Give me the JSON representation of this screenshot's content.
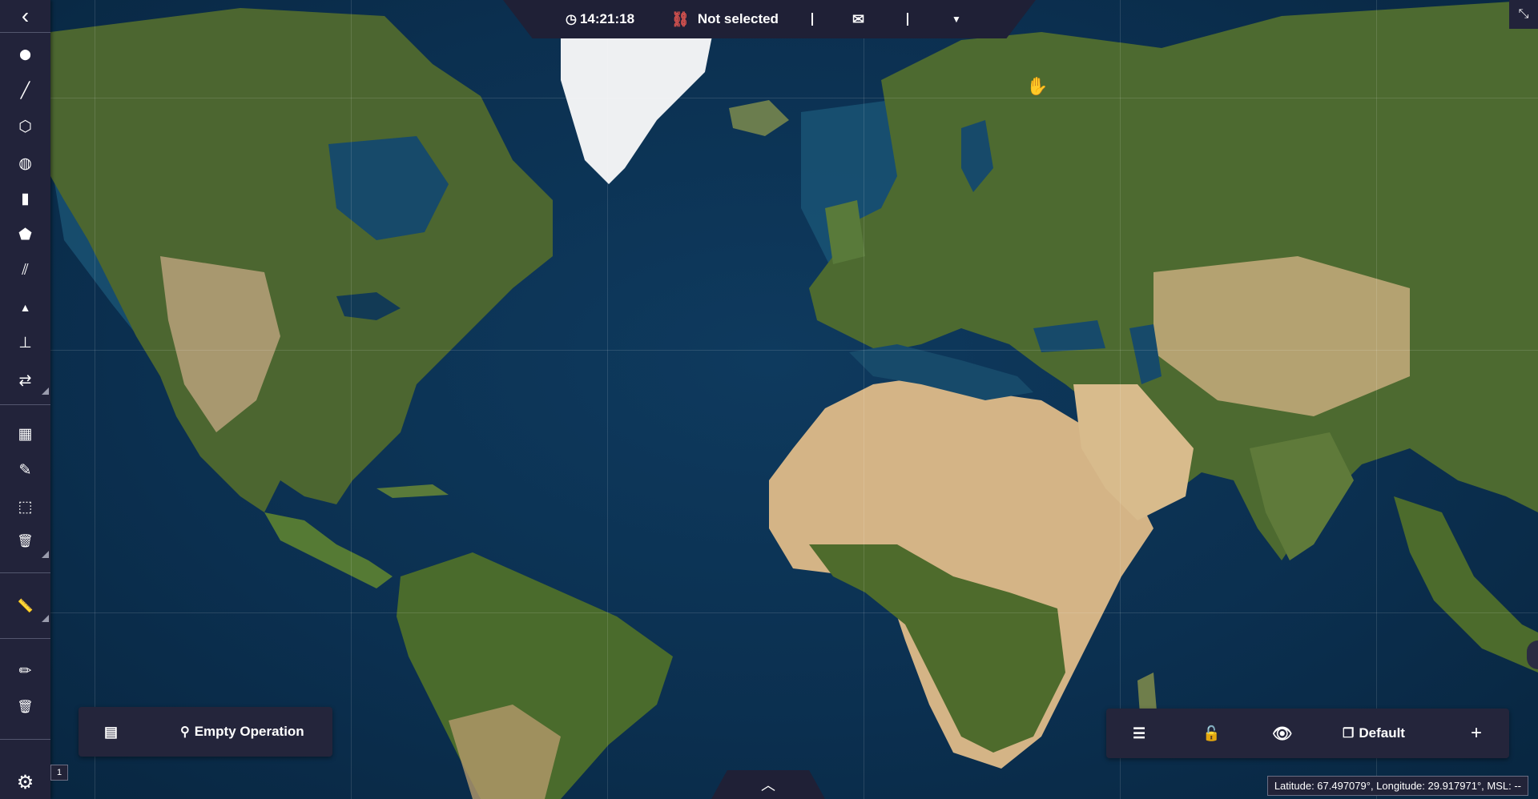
{
  "topbar": {
    "clock_icon": "clock-icon",
    "time": "14:21:18",
    "link_icon": "link-broken-icon",
    "link_icon_color": "#d9534f",
    "selection": "Not selected",
    "mail_icon": "envelope-icon",
    "dropdown_icon": "caret-down-icon"
  },
  "sidebar": {
    "items": [
      {
        "icon": "chevron-left-icon",
        "glyph": "‹"
      },
      {
        "icon": "map-pin-icon",
        "glyph": "⬤"
      },
      {
        "icon": "line-tool-icon",
        "glyph": "╱"
      },
      {
        "icon": "polygon-draw-icon",
        "glyph": "⬡"
      },
      {
        "icon": "globe-icon",
        "glyph": "◍"
      },
      {
        "icon": "cylinder-icon",
        "glyph": "▮"
      },
      {
        "icon": "pentagon-icon",
        "glyph": "⬟"
      },
      {
        "icon": "road-icon",
        "glyph": "⫽"
      },
      {
        "icon": "terrain-icon",
        "glyph": "▲"
      },
      {
        "icon": "pushpin-icon",
        "glyph": "⊥"
      },
      {
        "icon": "route-icon",
        "glyph": "⇄"
      },
      {
        "icon": "table-icon",
        "glyph": "▦"
      },
      {
        "icon": "edit-icon",
        "glyph": "✎"
      },
      {
        "icon": "select-area-icon",
        "glyph": "⬚"
      },
      {
        "icon": "trash-icon",
        "glyph": "🗑"
      },
      {
        "icon": "ruler-icon",
        "glyph": "📏"
      },
      {
        "icon": "pencil-icon",
        "glyph": "✏"
      },
      {
        "icon": "trash-icon",
        "glyph": "🗑"
      },
      {
        "icon": "gear-icon",
        "glyph": "⚙"
      }
    ]
  },
  "operation_panel": {
    "list_icon": "list-icon",
    "operation_icon": "operation-icon",
    "label": "Empty Operation"
  },
  "layer_panel": {
    "sort_icon": "sort-icon",
    "lock_icon": "unlock-icon",
    "eye_icon": "eye-icon",
    "layers_icon": "layers-icon",
    "label": "Default",
    "add_icon": "plus-icon"
  },
  "bottom_toggle_icon": "chevron-up-icon",
  "exit_fullscreen_icon": "compress-icon",
  "status": {
    "coordinates": "Latitude: 67.497079°, Longitude: 29.917971°, MSL: --"
  },
  "small_tag": "1",
  "colors": {
    "panel_bg": "#24253b",
    "sidebar_bg": "#22233a",
    "ocean": "#0d3a5c",
    "land_green": "#3f5a2c",
    "desert": "#c9a874",
    "ice": "#f2f2f2"
  }
}
